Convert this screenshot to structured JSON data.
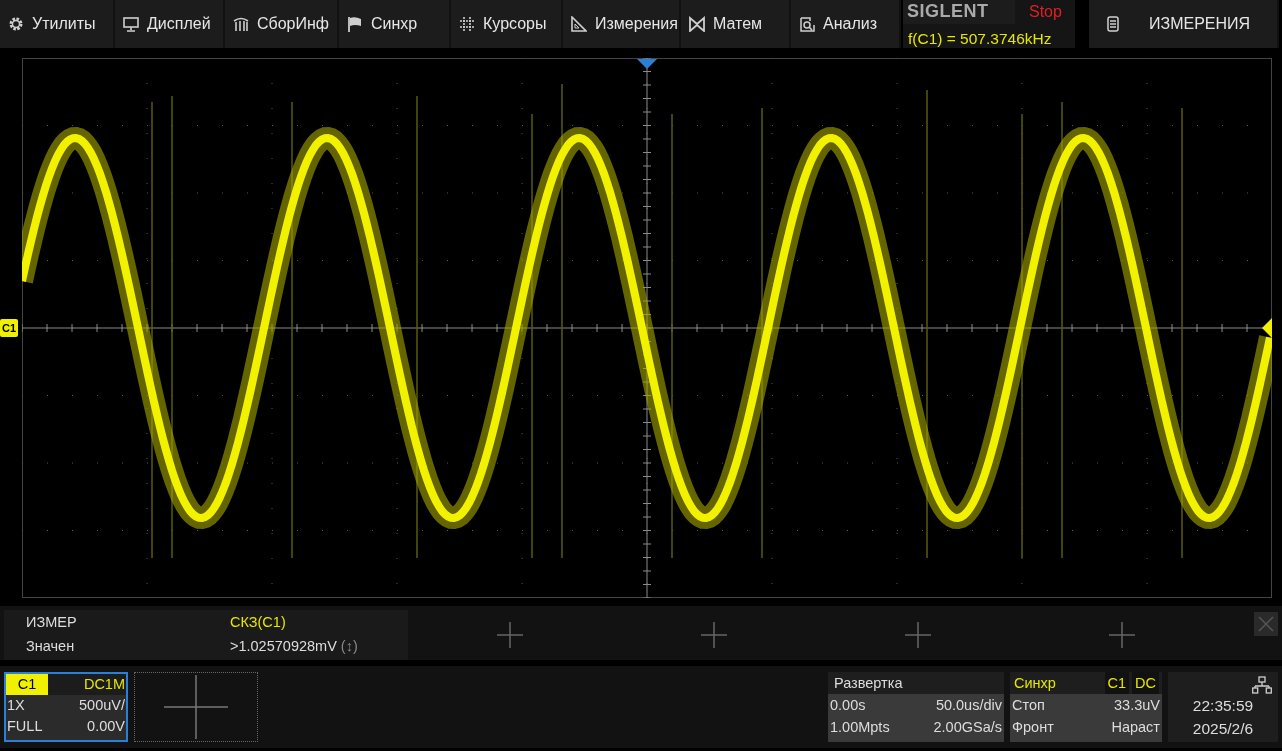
{
  "menu": [
    {
      "label": "Утилиты"
    },
    {
      "label": "Дисплей"
    },
    {
      "label": "СборИнф"
    },
    {
      "label": "Синхр"
    },
    {
      "label": "Курсоры"
    },
    {
      "label": "Измерения"
    },
    {
      "label": "Матем"
    },
    {
      "label": "Анализ"
    }
  ],
  "brand": "SIGLENT",
  "run_state": "Stop",
  "frequency_readout": "f(C1) = 507.3746kHz",
  "measure_button": "ИЗМЕРЕНИЯ",
  "channel_marker": "C1",
  "measure_panel": {
    "header_label": "ИЗМЕР",
    "value_label": "Значен",
    "slots": [
      {
        "kind": "measurement",
        "name": "СКЗ(C1)",
        "value": ">1.02570928mV",
        "status_glyph": "(↕)"
      },
      {
        "kind": "empty"
      },
      {
        "kind": "empty"
      },
      {
        "kind": "empty"
      },
      {
        "kind": "empty"
      }
    ]
  },
  "channels": [
    {
      "kind": "channel",
      "name": "C1",
      "coupling": "DC1M",
      "probe": "1X",
      "scale": "500uV/",
      "bandwidth": "FULL",
      "offset": "0.00V",
      "selected": true
    },
    {
      "kind": "empty"
    }
  ],
  "timebase": {
    "title": "Развертка",
    "delay": "0.00s",
    "scale": "50.0us/div",
    "memory": "1.00Mpts",
    "sample_rate": "2.00GSa/s"
  },
  "trigger": {
    "title": "Синхр",
    "source": "C1",
    "coupling": "DC",
    "mode": "Стоп",
    "level": "33.3uV",
    "type": "Фронт",
    "slope": "Нараст"
  },
  "clock": {
    "time": "22:35:59",
    "date": "2025/2/6"
  }
}
